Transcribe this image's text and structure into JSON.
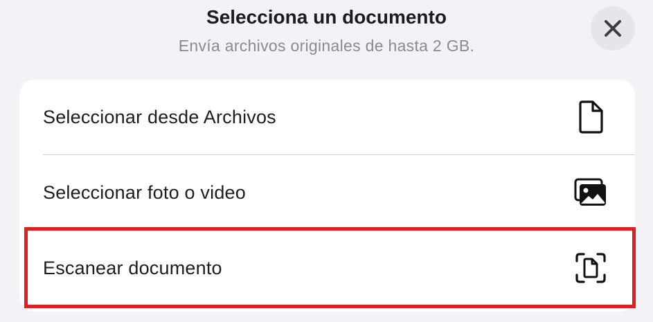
{
  "header": {
    "title": "Selecciona un documento",
    "subtitle": "Envía archivos originales de hasta 2 GB."
  },
  "close_icon": "xmark-icon",
  "options": [
    {
      "label": "Seleccionar desde Archivos",
      "icon": "document-icon"
    },
    {
      "label": "Seleccionar foto o video",
      "icon": "photos-icon"
    },
    {
      "label": "Escanear documento",
      "icon": "document-scanner-icon"
    }
  ],
  "colors": {
    "background": "#f2f2f7",
    "card": "#ffffff",
    "highlight": "#e02020",
    "secondary_text": "#8a8a8e"
  }
}
